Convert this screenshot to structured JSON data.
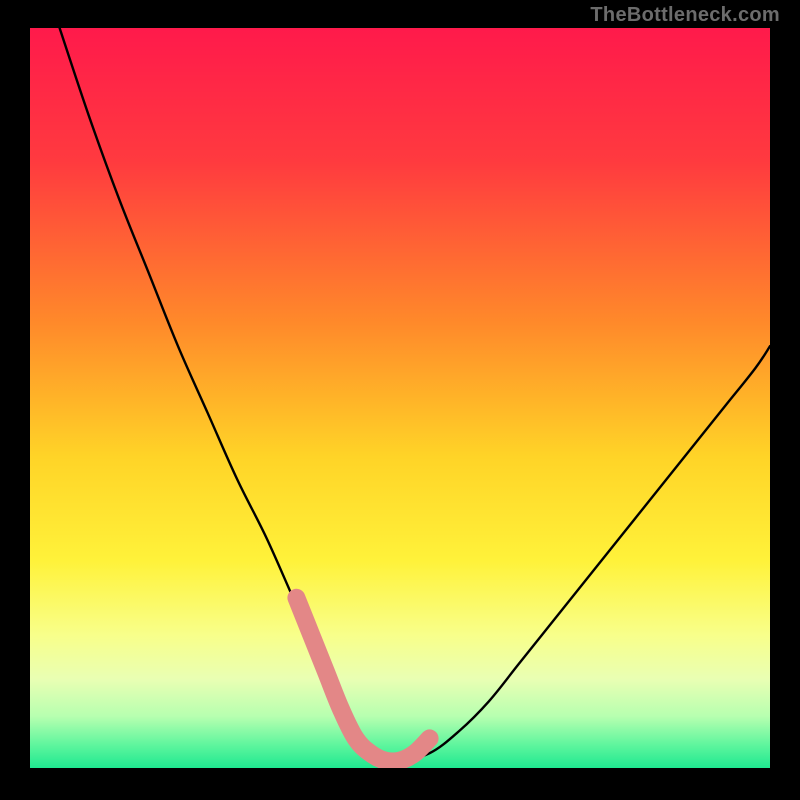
{
  "watermark": {
    "text": "TheBottleneck.com"
  },
  "chart_data": {
    "type": "line",
    "title": "",
    "xlabel": "",
    "ylabel": "",
    "xlim": [
      0,
      100
    ],
    "ylim": [
      0,
      100
    ],
    "grid": false,
    "series": [
      {
        "name": "bottleneck-curve",
        "x": [
          4,
          8,
          12,
          16,
          20,
          24,
          28,
          32,
          36,
          38,
          40,
          42,
          44,
          46,
          48,
          50,
          54,
          58,
          62,
          66,
          70,
          74,
          78,
          82,
          86,
          90,
          94,
          98,
          100
        ],
        "values": [
          100,
          88,
          77,
          67,
          57,
          48,
          39,
          31,
          22,
          18,
          13,
          8,
          4,
          2,
          1,
          1,
          2,
          5,
          9,
          14,
          19,
          24,
          29,
          34,
          39,
          44,
          49,
          54,
          57
        ]
      }
    ],
    "annotations": [
      {
        "name": "valley-highlight",
        "color": "#e38787",
        "x": [
          36,
          38,
          40,
          42,
          44,
          46,
          48,
          50,
          52,
          54
        ],
        "values": [
          23,
          18,
          13,
          8,
          4,
          2,
          1,
          1,
          2,
          4
        ]
      }
    ],
    "background_gradient": {
      "stops": [
        {
          "offset": 0.0,
          "color": "#ff1a4b"
        },
        {
          "offset": 0.18,
          "color": "#ff3a3f"
        },
        {
          "offset": 0.4,
          "color": "#ff8a2a"
        },
        {
          "offset": 0.58,
          "color": "#ffd427"
        },
        {
          "offset": 0.72,
          "color": "#fff23a"
        },
        {
          "offset": 0.82,
          "color": "#f8ff8a"
        },
        {
          "offset": 0.88,
          "color": "#e9ffb3"
        },
        {
          "offset": 0.93,
          "color": "#b7ffb0"
        },
        {
          "offset": 0.97,
          "color": "#5cf59d"
        },
        {
          "offset": 1.0,
          "color": "#1fe890"
        }
      ]
    }
  }
}
